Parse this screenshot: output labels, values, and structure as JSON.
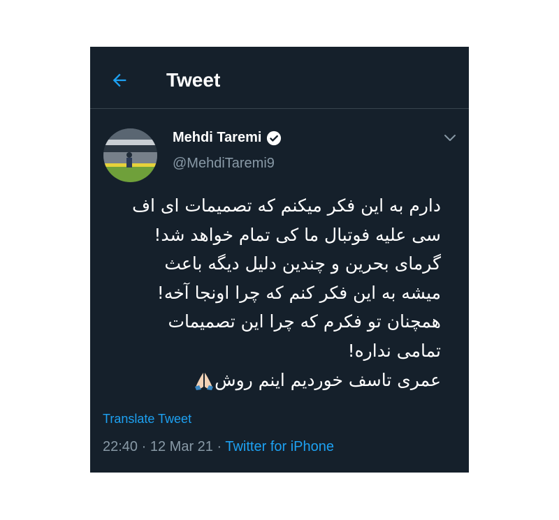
{
  "header": {
    "title": "Tweet",
    "back_icon": "arrow-left-icon"
  },
  "author": {
    "name": "Mehdi Taremi",
    "handle": "@MehdiTaremi9",
    "verified": true
  },
  "tweet": {
    "lines": [
      "دارم به این فکر میکنم که تصمیمات ای اف",
      "سی علیه فوتبال ما کی تمام خواهد شد!",
      "گرمای بحرین و چندین دلیل دیگه باعث",
      "میشه به این فکر کنم که چرا اونجا آخه!",
      "همچنان تو فکرم که چرا این تصمیمات",
      "تمامی نداره!",
      "عمری تاسف خوردیم اینم روش"
    ],
    "emoji": "folded-hands-icon"
  },
  "translate_label": "Translate Tweet",
  "meta": {
    "time": "22:40",
    "separator": "·",
    "date": "12 Mar 21",
    "source": "Twitter for iPhone"
  },
  "colors": {
    "background": "#15202b",
    "accent": "#1da1f2",
    "secondary_text": "#8899a6",
    "divider": "#38444d"
  }
}
